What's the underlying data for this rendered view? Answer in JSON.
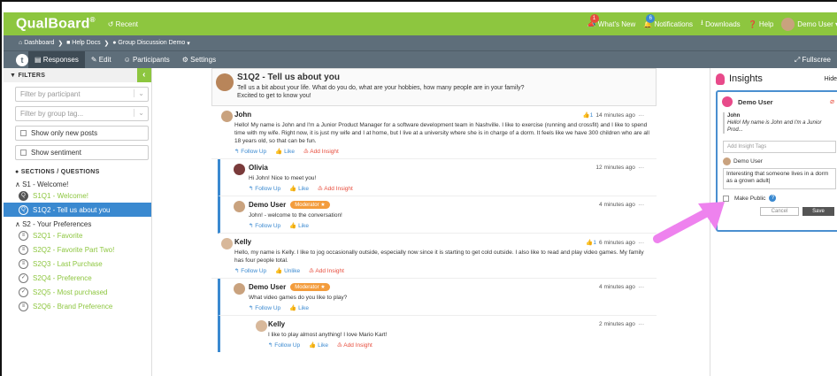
{
  "app": {
    "logo": "QualBoard",
    "reg": "®",
    "recent": "Recent"
  },
  "topnav": {
    "whats_new": "What's New",
    "whats_new_badge": "1",
    "notifications": "Notifications",
    "notif_badge": "6",
    "downloads": "Downloads",
    "help": "Help",
    "user": "Demo User"
  },
  "breadcrumb": {
    "dashboard": "Dashboard",
    "help_docs": "Help Docs",
    "group": "Group Discussion Demo"
  },
  "tabs": {
    "responses": "Responses",
    "edit": "Edit",
    "participants": "Participants",
    "settings": "Settings",
    "fullscreen": "Fullscree"
  },
  "filters": {
    "title": "FILTERS",
    "by_participant": "Filter by participant",
    "by_group": "Filter by group tag...",
    "only_new": "Show only new posts",
    "sentiment": "Show sentiment"
  },
  "sections": {
    "title": "SECTIONS / QUESTIONS",
    "s1": "S1 - Welcome!",
    "s1_items": [
      {
        "label": "S1Q1 - Welcome!",
        "icon": "Q"
      },
      {
        "label": "S1Q2 - Tell us about you",
        "icon": "Q"
      }
    ],
    "s2": "S2 - Your Preferences",
    "s2_items": [
      {
        "label": "S2Q1 - Favorite"
      },
      {
        "label": "S2Q2 - Favorite Part Two!"
      },
      {
        "label": "S2Q3 - Last Purchase"
      },
      {
        "label": "S2Q4 - Preference"
      },
      {
        "label": "S2Q5 - Most purchased"
      },
      {
        "label": "S2Q6 - Brand Preference"
      }
    ]
  },
  "question": {
    "title": "S1Q2 - Tell us about you",
    "desc1": "Tell us a bit about your life. What do you do, what are your hobbies, how many people are in your family?",
    "desc2": "Excited to get to know you!"
  },
  "posts": {
    "john": {
      "name": "John",
      "likes": "1",
      "time": "14 minutes ago",
      "text": "Hello! My name is John and I'm a Junior Product Manager for a software development team in Nashville. I like to exercise (running and crossfit) and I like to spend time with my wife. Right now, it is just my wife and I at home, but I live at a university where she is in charge of a dorm. It feels like we have 300 children who are all 18 years old, so that can be fun."
    },
    "olivia": {
      "name": "Olivia",
      "time": "12 minutes ago",
      "text": "Hi John! Nice to meet you!"
    },
    "demo1": {
      "name": "Demo User",
      "badge": "Moderator",
      "time": "4 minutes ago",
      "text": "John! - welcome to the conversation!"
    },
    "kelly": {
      "name": "Kelly",
      "likes": "1",
      "time": "6 minutes ago",
      "text": "Hello, my name is Kelly. I like to jog occasionally outside, especially now since it is starting to get cold outside. I also like to read and play video games. My family has four people total."
    },
    "demo2": {
      "name": "Demo User",
      "badge": "Moderator",
      "time": "4 minutes ago",
      "text": "What video games do you like to play?"
    },
    "kelly2": {
      "name": "Kelly",
      "time": "2 minutes ago",
      "text": "I like to play almost anything! I love Mario Kart!"
    }
  },
  "actions": {
    "follow": "Follow Up",
    "like": "Like",
    "unlike": "Unlike",
    "insight": "Add Insight",
    "more": "···"
  },
  "insights": {
    "title": "Insights",
    "hide": "Hide",
    "card_user": "Demo User",
    "quote_name": "John",
    "quote_text": "Hello! My name is John and I'm a Junior Prod...",
    "tags_placeholder": "Add Insight Tags",
    "author": "Demo User",
    "note": "Interesting that someone lives in a dorm as a grown adult|",
    "make_public": "Make Public",
    "cancel": "Cancel",
    "save": "Save"
  },
  "colors": {
    "brand_green": "#8dc63f",
    "nav_gray": "#5e6e7a",
    "accent_blue": "#3a89d0",
    "moderator_orange": "#f39c3c",
    "insight_pink": "#e84a8a"
  }
}
